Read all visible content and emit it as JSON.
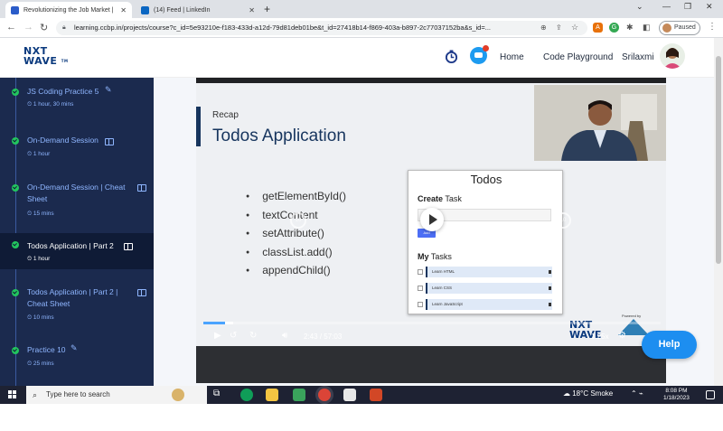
{
  "browser": {
    "tabs": [
      {
        "title": "Revolutionizing the Job Market |",
        "active": true,
        "favicon_color": "#2b5cc9"
      },
      {
        "title": "(14) Feed | LinkedIn",
        "active": false,
        "favicon_color": "#0a66c2"
      }
    ],
    "url": "learning.ccbp.in/projects/course?c_id=5e93210e-f183-433d-a12d-79d81deb01be&t_id=27418b14-f869-403a-b897-2c77037152ba&s_id=...",
    "profile_label": "Paused"
  },
  "header": {
    "logo_top": "NXT",
    "logo_bottom": "WAVE",
    "logo_tm": "TM",
    "nav": [
      {
        "label": "Home"
      },
      {
        "label": "Code Playground"
      },
      {
        "label": "Srilaxmi"
      }
    ]
  },
  "sidebar": {
    "items": [
      {
        "title": "JS Coding Practice 5",
        "duration": "1 hour, 30 mins",
        "icon": "pencil-icon",
        "active": false
      },
      {
        "title": "On-Demand Session",
        "duration": "1 hour",
        "icon": "book-icon",
        "active": false
      },
      {
        "title": "On-Demand Session | Cheat Sheet",
        "title_line1": "On-Demand Session | Cheat",
        "title_line2": "Sheet",
        "duration": "15 mins",
        "icon": "book-icon",
        "active": false
      },
      {
        "title": "Todos Application | Part 2",
        "duration": "1 hour",
        "icon": "book-icon",
        "active": true
      },
      {
        "title": "Todos Application | Part 2 | Cheat Sheet",
        "title_line1": "Todos Application | Part 2 |",
        "title_line2": "Cheat Sheet",
        "duration": "10 mins",
        "icon": "book-icon",
        "active": false
      },
      {
        "title": "Practice 10",
        "duration": "25 mins",
        "icon": "pencil-icon",
        "active": false
      }
    ]
  },
  "video": {
    "slide": {
      "kicker": "Recap",
      "title": "Todos Application",
      "bullets": [
        "getElementById()",
        "textContent",
        "setAttribute()",
        "classList.add()",
        "appendChild()"
      ],
      "card": {
        "title": "Todos",
        "create_bold": "Create",
        "create_rest": " Task",
        "add_label": "Add",
        "tasks_bold": "My",
        "tasks_rest": " Tasks",
        "todos": [
          "Learn HTML",
          "Learn CSS",
          "Learn JavaScript"
        ]
      },
      "watermark_top": "NXT",
      "watermark_bottom": "WAVE",
      "powered_by": "Powered by"
    },
    "ghost_back": "10",
    "ghost_fwd": "10",
    "current_time": "2:43",
    "separator": "/",
    "duration": "57:03",
    "progress_fraction": 0.0476,
    "speed": "1.25x"
  },
  "help_label": "Help",
  "taskbar": {
    "search_placeholder": "Type here to search",
    "weather": "18°C  Smoke",
    "time": "8:08 PM",
    "date": "1/18/2023"
  }
}
